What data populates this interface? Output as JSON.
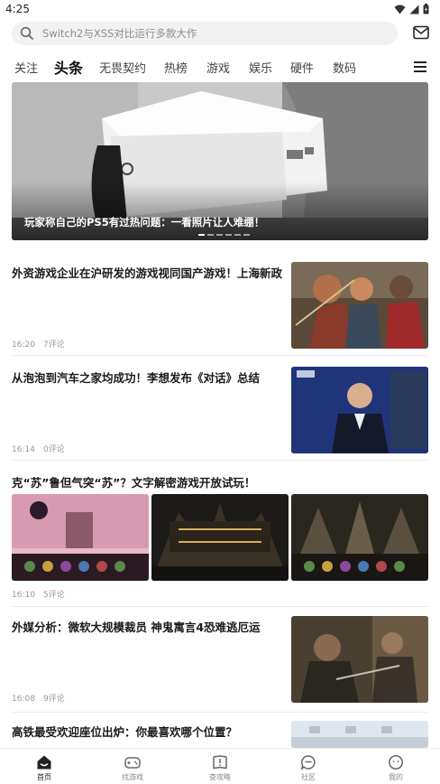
{
  "status_bar": {
    "time": "4:25",
    "icons": [
      "wifi-icon",
      "signal-icon",
      "battery-icon"
    ]
  },
  "search": {
    "placeholder": "Switch2与XSS对比运行多款大作",
    "icon": "search-icon",
    "mail_icon": "mail-icon"
  },
  "tabs": [
    {
      "label": "关注",
      "active": false
    },
    {
      "label": "头条",
      "active": true
    },
    {
      "label": "无畏契约",
      "active": false
    },
    {
      "label": "热榜",
      "active": false
    },
    {
      "label": "游戏",
      "active": false
    },
    {
      "label": "娱乐",
      "active": false
    },
    {
      "label": "硬件",
      "active": false
    },
    {
      "label": "数码",
      "active": false
    }
  ],
  "menu_icon": "menu-icon",
  "banner": {
    "caption": "玩家称自己的PS5有过热问题：一看照片让人难绷！",
    "dot_count": 6,
    "active_dot": 0
  },
  "news": [
    {
      "title": "外资游戏企业在沪研发的游戏视同国产游戏！上海新政",
      "time": "16:20",
      "comments": "7评论"
    },
    {
      "title": "从泡泡到汽车之家均成功！李想发布《对话》总结",
      "time": "16:14",
      "comments": "0评论"
    },
    {
      "title": "克“苏”鲁但气突“苏”？文字解密游戏开放试玩！",
      "time": "16:10",
      "comments": "5评论"
    },
    {
      "title": "外媒分析：微软大规模裁员 神鬼寓言4恐难逃厄运",
      "time": "16:08",
      "comments": "9评论"
    },
    {
      "title": "高铁最受欢迎座位出炉：你最喜欢哪个位置？",
      "time": "",
      "comments": ""
    }
  ],
  "bottom_nav": [
    {
      "label": "首页",
      "icon": "home-icon",
      "active": true
    },
    {
      "label": "找游戏",
      "icon": "gamepad-icon",
      "active": false
    },
    {
      "label": "查攻略",
      "icon": "guide-book-icon",
      "active": false
    },
    {
      "label": "社区",
      "icon": "community-chat-icon",
      "active": false
    },
    {
      "label": "我的",
      "icon": "profile-face-icon",
      "active": false
    }
  ],
  "colors": {
    "accent": "#111111",
    "search_bg": "#f2f2f2",
    "meta_text": "#999999"
  }
}
